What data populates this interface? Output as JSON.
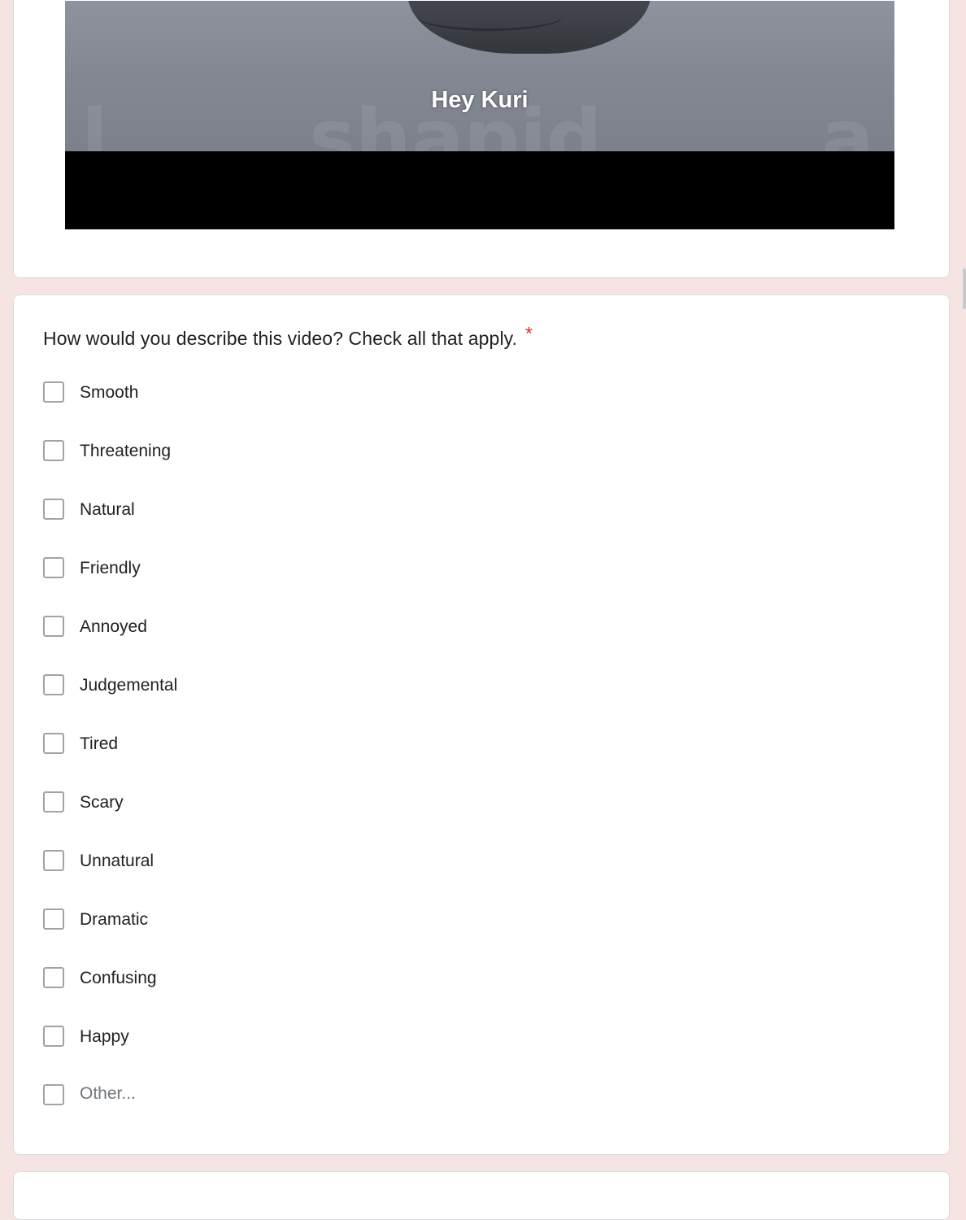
{
  "video": {
    "caption": "Hey Kuri"
  },
  "question": {
    "title": "How would you describe this video? Check all that apply.",
    "required_marker": "*",
    "options": [
      {
        "label": "Smooth",
        "checked": false
      },
      {
        "label": "Threatening",
        "checked": false
      },
      {
        "label": "Natural",
        "checked": false
      },
      {
        "label": "Friendly",
        "checked": false
      },
      {
        "label": "Annoyed",
        "checked": false
      },
      {
        "label": "Judgemental",
        "checked": false
      },
      {
        "label": "Tired",
        "checked": false
      },
      {
        "label": "Scary",
        "checked": false
      },
      {
        "label": "Unnatural",
        "checked": false
      },
      {
        "label": "Dramatic",
        "checked": false
      },
      {
        "label": "Confusing",
        "checked": false
      },
      {
        "label": "Happy",
        "checked": false
      }
    ],
    "other_placeholder": "Other..."
  },
  "colors": {
    "page_background": "#f6e4e3",
    "card_background": "#ffffff",
    "required_star": "#d93025",
    "checkbox_border": "#a3a3a3"
  }
}
